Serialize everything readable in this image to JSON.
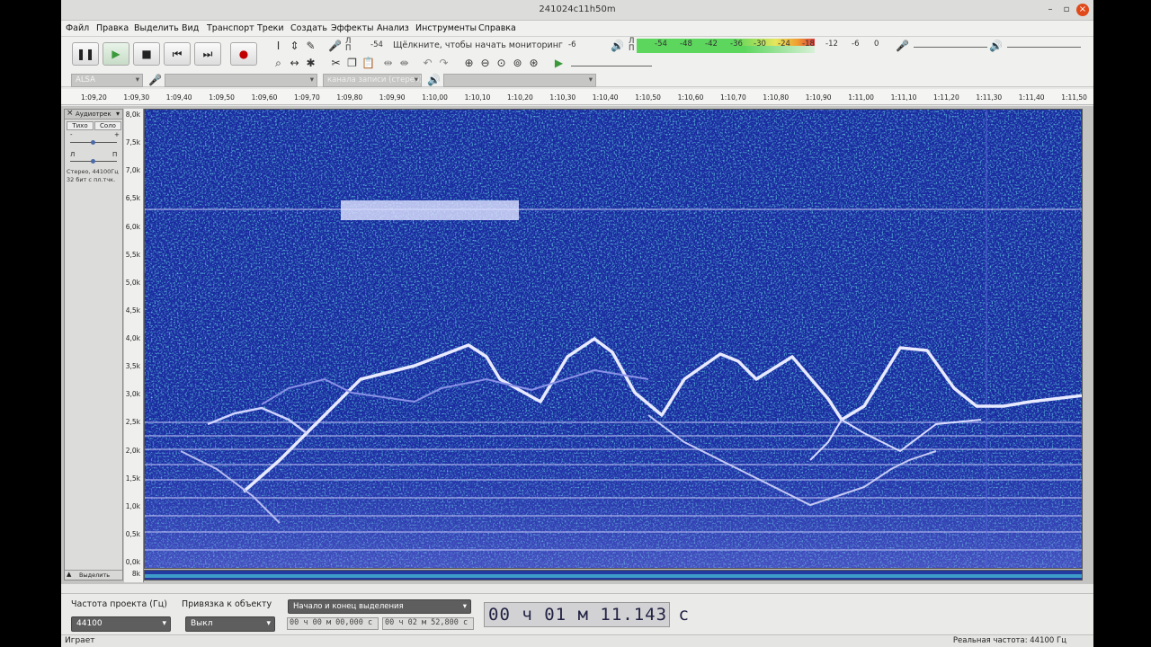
{
  "window": {
    "title": "241024c11h50m"
  },
  "menu": [
    "Файл",
    "Правка",
    "Выделить",
    "Вид",
    "Транспорт",
    "Треки",
    "Создать",
    "Эффекты",
    "Анализ",
    "Инструменты",
    "Справка"
  ],
  "meter": {
    "rec_labels": [
      "-54",
      "-6"
    ],
    "monitor_text": "Щёлкните, чтобы начать мониторинг",
    "lr": [
      "Л",
      "П"
    ],
    "play_scale": [
      "-54",
      "-48",
      "-42",
      "-36",
      "-30",
      "-24",
      "-18",
      "-12",
      "-6",
      "0"
    ]
  },
  "device": {
    "host": "ALSA",
    "channels": "канала записи (стерео)"
  },
  "ruler": {
    "ticks": [
      "1:09,20",
      "1:09,30",
      "1:09,40",
      "1:09,50",
      "1:09,60",
      "1:09,70",
      "1:09,80",
      "1:09,90",
      "1:10,00",
      "1:10,10",
      "1:10,20",
      "1:10,30",
      "1:10,40",
      "1:10,50",
      "1:10,60",
      "1:10,70",
      "1:10,80",
      "1:10,90",
      "1:11,00",
      "1:11,10",
      "1:11,20",
      "1:11,30",
      "1:11,40",
      "1:11,50"
    ]
  },
  "track": {
    "name": "Аудиотрек",
    "mute": "Тихо",
    "solo": "Соло",
    "pan_left": "Л",
    "pan_right": "П",
    "gain_minus": "-",
    "gain_plus": "+",
    "info1": "Стерео, 44100Гц",
    "info2": "32 бит с пл.тчк.",
    "select_label": "Выделить"
  },
  "freq_axis": {
    "labels": [
      "8,0k",
      "7,5k",
      "7,0k",
      "6,5k",
      "6,0k",
      "5,5k",
      "5,0k",
      "4,5k",
      "4,0k",
      "3,5k",
      "3,0k",
      "2,5k",
      "2,0k",
      "1,5k",
      "1,0k",
      "0,5k",
      "0,0k"
    ],
    "bottom": "8k"
  },
  "bottom": {
    "rate_label": "Частота проекта (Гц)",
    "rate_value": "44100",
    "snap_label": "Привязка к объекту",
    "snap_value": "Выкл",
    "selection_mode": "Начало и конец выделения",
    "sel_start": "00 ч 00 м 00,000 с",
    "sel_end": "00 ч 02 м 52,800 с",
    "time": "00 ч 01 м 11.143 с"
  },
  "status": {
    "left": "Играет",
    "right": "Реальная частота: 44100 Гц"
  },
  "colors": {
    "spectrogram_bg": "#1a2aa0",
    "play_green": "#3a9a3a",
    "record_red": "#c00000"
  }
}
